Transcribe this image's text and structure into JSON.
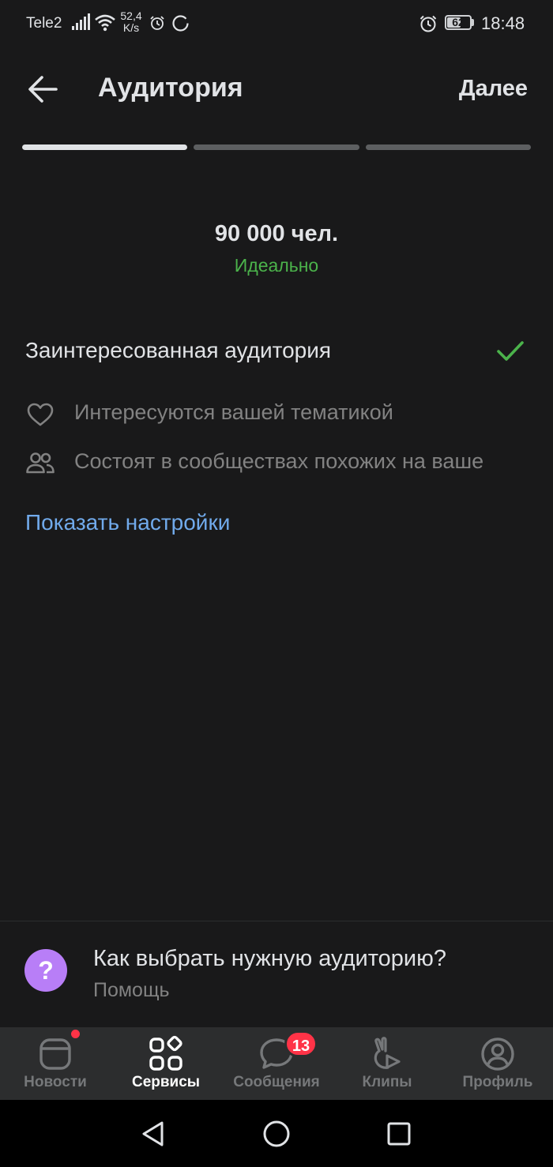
{
  "status_bar": {
    "carrier": "Tele2",
    "net_speed_value": "52,4",
    "net_speed_unit": "K/s",
    "battery_level": "62",
    "battery_fraction": 0.62,
    "time": "18:48"
  },
  "header": {
    "back_icon": "arrow-left-icon",
    "title": "Аудитория",
    "next_label": "Далее"
  },
  "progress": {
    "steps": [
      1.0,
      0.0,
      0.0
    ]
  },
  "summary": {
    "audience_count": "90 000 чел.",
    "rating": "Идеально",
    "rating_color": "#4bb34b"
  },
  "audience": {
    "title": "Заинтересованная аудитория",
    "selected_icon": "check-icon",
    "criteria": [
      {
        "icon": "heart-icon",
        "label": "Интересуются вашей тематикой"
      },
      {
        "icon": "users-icon",
        "label": "Состоят в сообществах похожих на ваше"
      }
    ],
    "show_settings": "Показать настройки",
    "link_color": "#71aaeb"
  },
  "help": {
    "icon": "question-icon",
    "icon_glyph": "?",
    "title": "Как выбрать нужную аудиторию?",
    "subtitle": "Помощь",
    "accent": "#b87ef7"
  },
  "tabbar": {
    "tabs": [
      {
        "icon": "newsfeed-icon",
        "label": "Новости",
        "active": false
      },
      {
        "icon": "services-icon",
        "label": "Сервисы",
        "active": true
      },
      {
        "icon": "messages-icon",
        "label": "Сообщения",
        "active": false,
        "badge": "13"
      },
      {
        "icon": "clips-icon",
        "label": "Клипы",
        "active": false
      },
      {
        "icon": "profile-icon",
        "label": "Профиль",
        "active": false
      }
    ]
  },
  "system_nav": {
    "buttons": [
      "back-triangle-icon",
      "home-circle-icon",
      "recents-square-icon"
    ]
  }
}
